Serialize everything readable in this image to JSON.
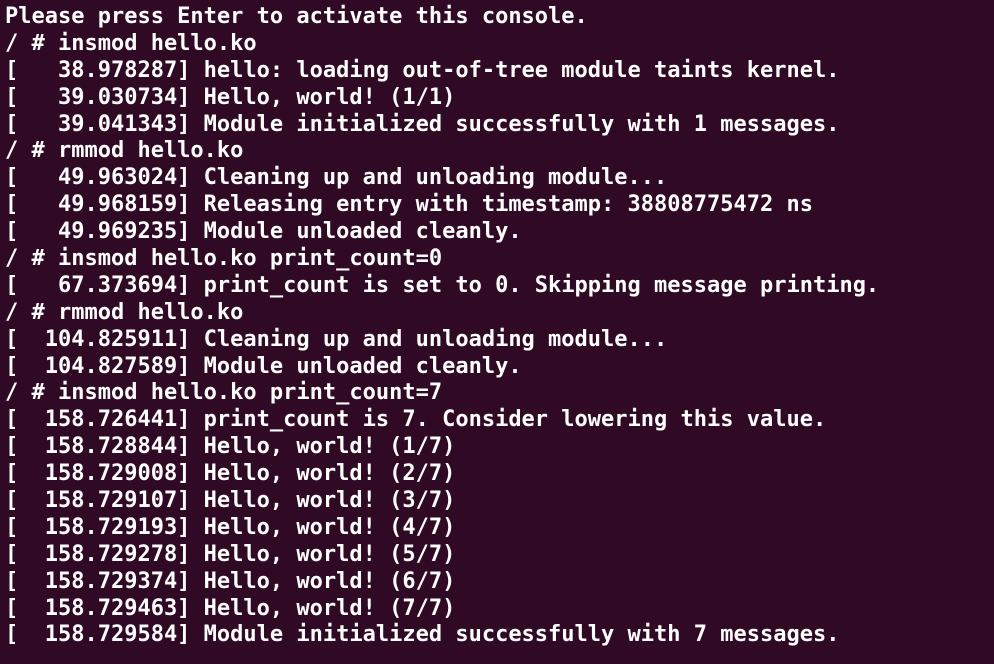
{
  "terminal": {
    "background": "#300a24",
    "foreground": "#ffffff",
    "lines": [
      "Please press Enter to activate this console.",
      "/ # insmod hello.ko",
      "[   38.978287] hello: loading out-of-tree module taints kernel.",
      "[   39.030734] Hello, world! (1/1)",
      "[   39.041343] Module initialized successfully with 1 messages.",
      "/ # rmmod hello.ko",
      "[   49.963024] Cleaning up and unloading module...",
      "[   49.968159] Releasing entry with timestamp: 38808775472 ns",
      "[   49.969235] Module unloaded cleanly.",
      "/ # insmod hello.ko print_count=0",
      "[   67.373694] print_count is set to 0. Skipping message printing.",
      "/ # rmmod hello.ko",
      "[  104.825911] Cleaning up and unloading module...",
      "[  104.827589] Module unloaded cleanly.",
      "/ # insmod hello.ko print_count=7",
      "[  158.726441] print_count is 7. Consider lowering this value.",
      "[  158.728844] Hello, world! (1/7)",
      "[  158.729008] Hello, world! (2/7)",
      "[  158.729107] Hello, world! (3/7)",
      "[  158.729193] Hello, world! (4/7)",
      "[  158.729278] Hello, world! (5/7)",
      "[  158.729374] Hello, world! (6/7)",
      "[  158.729463] Hello, world! (7/7)",
      "[  158.729584] Module initialized successfully with 7 messages."
    ]
  }
}
